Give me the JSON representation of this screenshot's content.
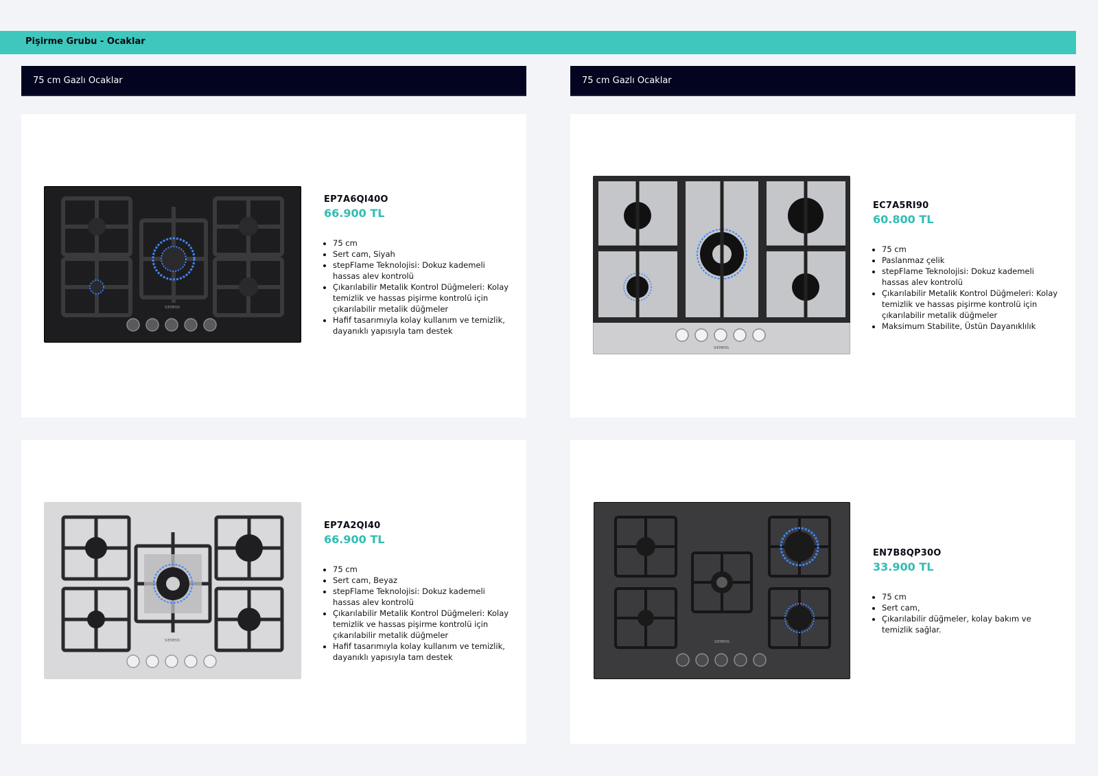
{
  "section": {
    "title": "Pişirme Grubu - Ocaklar"
  },
  "columns": [
    {
      "header": "75 cm Gazlı Ocaklar"
    },
    {
      "header": "75 cm Gazlı Ocaklar"
    }
  ],
  "brand": "SIEMENS",
  "products": [
    {
      "model": "EP7A6QI40O",
      "price": "66.900 TL",
      "features": [
        "75 cm",
        "Sert cam, Siyah",
        "stepFlame Teknolojisi: Dokuz kademeli hassas alev kontrolü",
        "Çıkarılabilir Metalik Kontrol Düğmeleri: Kolay temizlik ve hassas pişirme kontrolü için çıkarılabilir metalik düğmeler",
        "Hafif tasarımıyla kolay kullanım ve temizlik, dayanıklı yapısıyla tam destek"
      ]
    },
    {
      "model": "EC7A5RI90",
      "price": "60.800 TL",
      "features": [
        "75 cm",
        "Paslanmaz çelik",
        "stepFlame Teknolojisi: Dokuz kademeli hassas alev kontrolü",
        "Çıkarılabilir Metalik Kontrol Düğmeleri: Kolay temizlik ve hassas pişirme kontrolü için çıkarılabilir metalik düğmeler",
        "Maksimum Stabilite, Üstün Dayanıklılık"
      ]
    },
    {
      "model": "EP7A2QI40",
      "price": "66.900 TL",
      "features": [
        "75 cm",
        "Sert cam, Beyaz",
        "stepFlame Teknolojisi: Dokuz kademeli hassas alev kontrolü",
        "Çıkarılabilir Metalik Kontrol Düğmeleri: Kolay temizlik ve hassas pişirme kontrolü için çıkarılabilir metalik düğmeler",
        "Hafif tasarımıyla kolay kullanım ve temizlik, dayanıklı yapısıyla tam destek"
      ]
    },
    {
      "model": "EN7B8QP30O",
      "price": "33.900 TL",
      "features": [
        "75 cm",
        "Sert cam,",
        "Çıkarılabilir düğmeler, kolay bakım ve temizlik sağlar."
      ]
    }
  ],
  "colors": {
    "banner": "#3ec8bd",
    "header": "#03041f",
    "price": "#31bdb2"
  }
}
